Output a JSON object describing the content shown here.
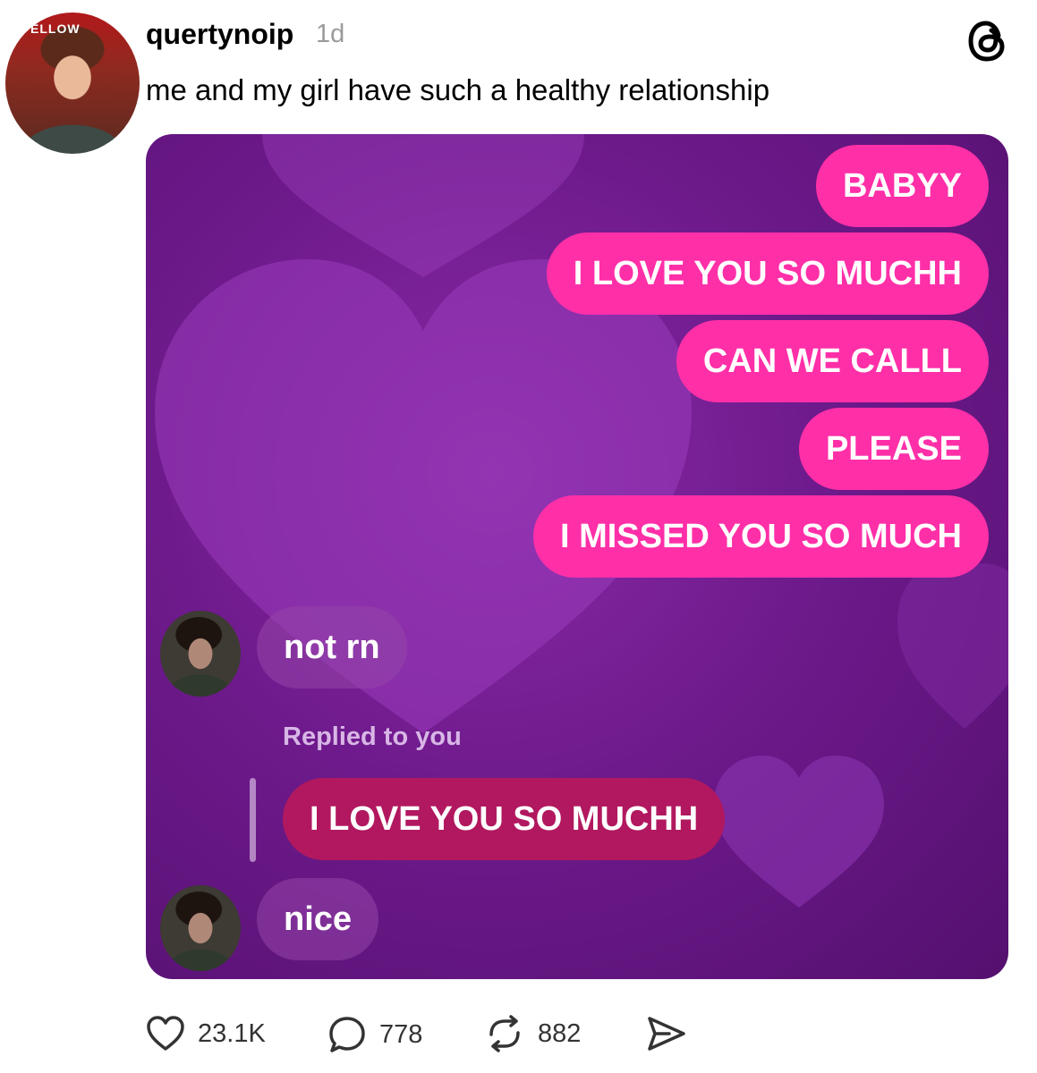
{
  "post": {
    "username": "quertynoip",
    "time": "1d",
    "caption": "me and my girl have such a healthy relationship",
    "avatar_sign_text": "ELLOW"
  },
  "icons": {
    "app_logo": "threads-logo-icon",
    "like": "heart-outline-icon",
    "reply": "speech-bubble-icon",
    "repost": "repost-arrows-icon",
    "share": "send-arrow-icon"
  },
  "chat": {
    "sent_messages": [
      "BABYY",
      "I LOVE YOU SO MUCHH",
      "CAN WE CALLL",
      "PLEASE",
      "I MISSED YOU SO MUCH"
    ],
    "reply_1": "not rn",
    "reply_label": "Replied to you",
    "quoted_message": "I LOVE YOU SO MUCHH",
    "reply_2": "nice"
  },
  "colors": {
    "sent_bubble": "#ff2fa8",
    "quoted_bubble": "#b1185f",
    "background_purple": "#6e1a8c"
  },
  "stats": {
    "likes": "23.1K",
    "replies": "778",
    "reposts": "882"
  }
}
